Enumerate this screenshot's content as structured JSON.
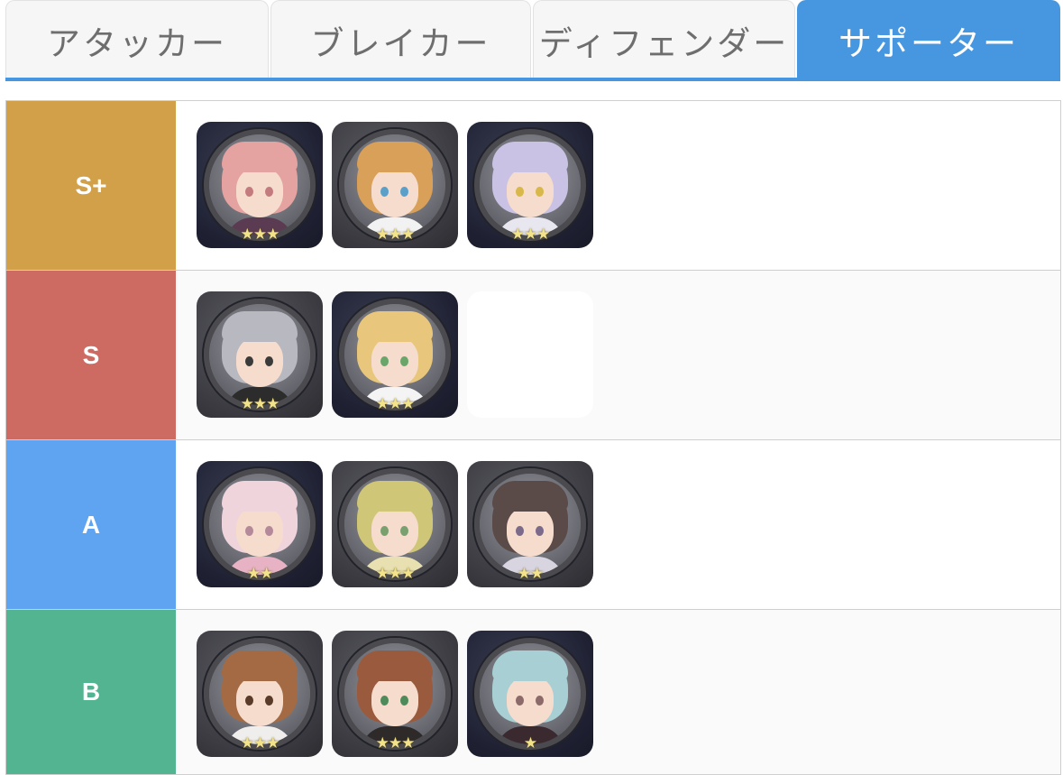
{
  "tabs": [
    {
      "label": "アタッカー",
      "active": false
    },
    {
      "label": "ブレイカー",
      "active": false
    },
    {
      "label": "ディフェンダー",
      "active": false
    },
    {
      "label": "サポーター",
      "active": true
    }
  ],
  "tiers": [
    {
      "label": "S+",
      "color": "#d2a049",
      "characters": [
        {
          "stars": "★★★",
          "hair": "#e4a2a0",
          "eye": "#c47b7e",
          "body": "#5b3b52"
        },
        {
          "stars": "★★★",
          "hair": "#d9a05a",
          "eye": "#5aa0c8",
          "body": "#f2f2f2"
        },
        {
          "stars": "★★★",
          "hair": "#c9c2e4",
          "eye": "#d8b84a",
          "body": "#e8e6ee"
        }
      ]
    },
    {
      "label": "S",
      "color": "#cd6b63",
      "characters": [
        {
          "stars": "★★★",
          "hair": "#b8b8c0",
          "eye": "#3a3a3a",
          "body": "#2c2c2c"
        },
        {
          "stars": "★★★",
          "hair": "#e8c77c",
          "eye": "#6aa56a",
          "body": "#f4f4f4"
        }
      ]
    },
    {
      "label": "A",
      "color": "#5fa4f0",
      "characters": [
        {
          "stars": "★★",
          "hair": "#f0d4dc",
          "eye": "#b48a9a",
          "body": "#e6b2c4"
        },
        {
          "stars": "★★★",
          "hair": "#cfc678",
          "eye": "#7aa070",
          "body": "#e8e0b0"
        },
        {
          "stars": "★★",
          "hair": "#5a4a48",
          "eye": "#7c6a8a",
          "body": "#d8d4e0"
        }
      ]
    },
    {
      "label": "B",
      "color": "#52b491",
      "characters": [
        {
          "stars": "★★★",
          "hair": "#a36a44",
          "eye": "#5a3a28",
          "body": "#f0eeec"
        },
        {
          "stars": "★★★",
          "hair": "#9a5a3e",
          "eye": "#4f8a5a",
          "body": "#2e2a2a"
        },
        {
          "stars": "★",
          "hair": "#a8d0d4",
          "eye": "#8c6a6a",
          "body": "#3a2a30"
        }
      ]
    }
  ]
}
